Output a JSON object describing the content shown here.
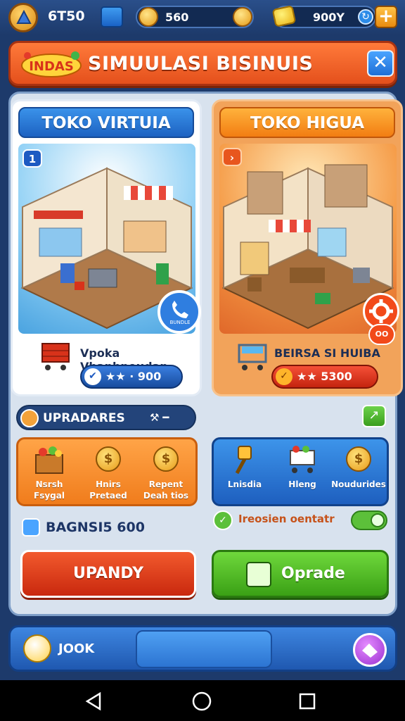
{
  "topbar": {
    "level": "6T50",
    "coins": "560",
    "gems": "900Y"
  },
  "title": {
    "logo_text": "INDAS",
    "text": "SIMUULASI BISINUIS"
  },
  "cards": [
    {
      "header": "TOKO VIRTUIA",
      "corner_badge": "1",
      "phone_label": "BUNDLE",
      "caption": "Vpoka Vhanhnoudan",
      "price": "★★ · 900",
      "price_icon": "check-icon"
    },
    {
      "header": "TOKO HIGUA",
      "corner_badge": "›",
      "caption": "BEIRSA SI HUIBA",
      "price": "★★ 5300",
      "badge_small": "OO"
    }
  ],
  "upgrades": {
    "title": "UPRADARES",
    "tools": "⚒ ━",
    "left_items": [
      {
        "label": "Nsrsh Fsygal",
        "icon": "basket-icon"
      },
      {
        "label": "Hnirs Pretaed",
        "icon": "coin-icon"
      },
      {
        "label": "Repent Deah tios",
        "icon": "coin-icon"
      }
    ],
    "right_items": [
      {
        "label": "Lnisdia",
        "icon": "pick-icon"
      },
      {
        "label": "Hleng",
        "icon": "cart-icon"
      },
      {
        "label": "Noudurides",
        "icon": "coin-icon"
      }
    ]
  },
  "balance": {
    "text": "BAGNSI5 600"
  },
  "status": {
    "text": "Ireosien oentatr"
  },
  "buttons": {
    "left": "UPANDY",
    "right": "Oprade"
  },
  "bottom": {
    "text": "JOOK"
  },
  "colors": {
    "accent_orange": "#e4501c",
    "accent_blue": "#1d62c2",
    "accent_green": "#3aa015",
    "accent_red": "#c9280e"
  }
}
